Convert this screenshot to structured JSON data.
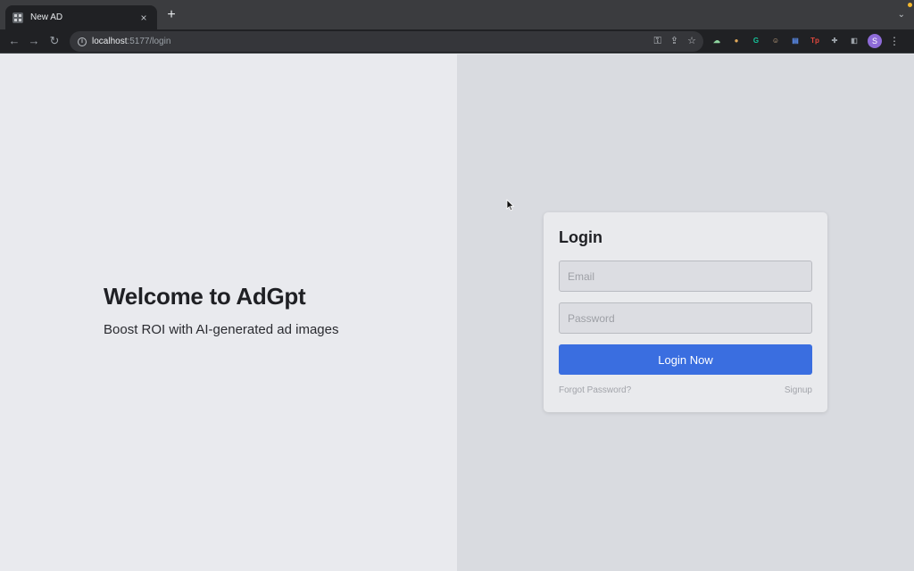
{
  "browser": {
    "tab_title": "New AD",
    "tab_close": "×",
    "new_tab": "+",
    "tab_search": "⌄",
    "url_host": "localhost",
    "url_rest": ":5177/login",
    "nav": {
      "back": "←",
      "forward": "→",
      "reload": "↻"
    },
    "omnibox_actions": {
      "key": "⚿",
      "share": "⇪",
      "bookmark": "☆"
    },
    "extensions": [
      {
        "name": "cloud-extension-icon",
        "glyph": "☁",
        "color": "#8fd6a0"
      },
      {
        "name": "cookie-extension-icon",
        "glyph": "●",
        "color": "#e0a85a"
      },
      {
        "name": "grammarly-extension-icon",
        "glyph": "G",
        "color": "#15c39a"
      },
      {
        "name": "face-extension-icon",
        "glyph": "☺",
        "color": "#d8b48c"
      },
      {
        "name": "document-extension-icon",
        "glyph": "▤",
        "color": "#5b8dee"
      },
      {
        "name": "tp-extension-icon",
        "glyph": "Tp",
        "color": "#e2483d"
      },
      {
        "name": "puzzle-extension-icon",
        "glyph": "✚",
        "color": "#9aa0a6"
      },
      {
        "name": "side-panel-icon",
        "glyph": "◧",
        "color": "#9aa0a6"
      }
    ],
    "profile_initial": "S",
    "menu": "⋮"
  },
  "hero": {
    "title": "Welcome to AdGpt",
    "subtitle": "Boost ROI with AI-generated ad images"
  },
  "login": {
    "title": "Login",
    "email_placeholder": "Email",
    "password_placeholder": "Password",
    "submit_label": "Login Now",
    "forgot_label": "Forgot Password?",
    "signup_label": "Signup"
  },
  "colors": {
    "primary": "#3a6ee0",
    "left_bg": "#e9eaee",
    "right_bg": "#d9dbe0"
  }
}
